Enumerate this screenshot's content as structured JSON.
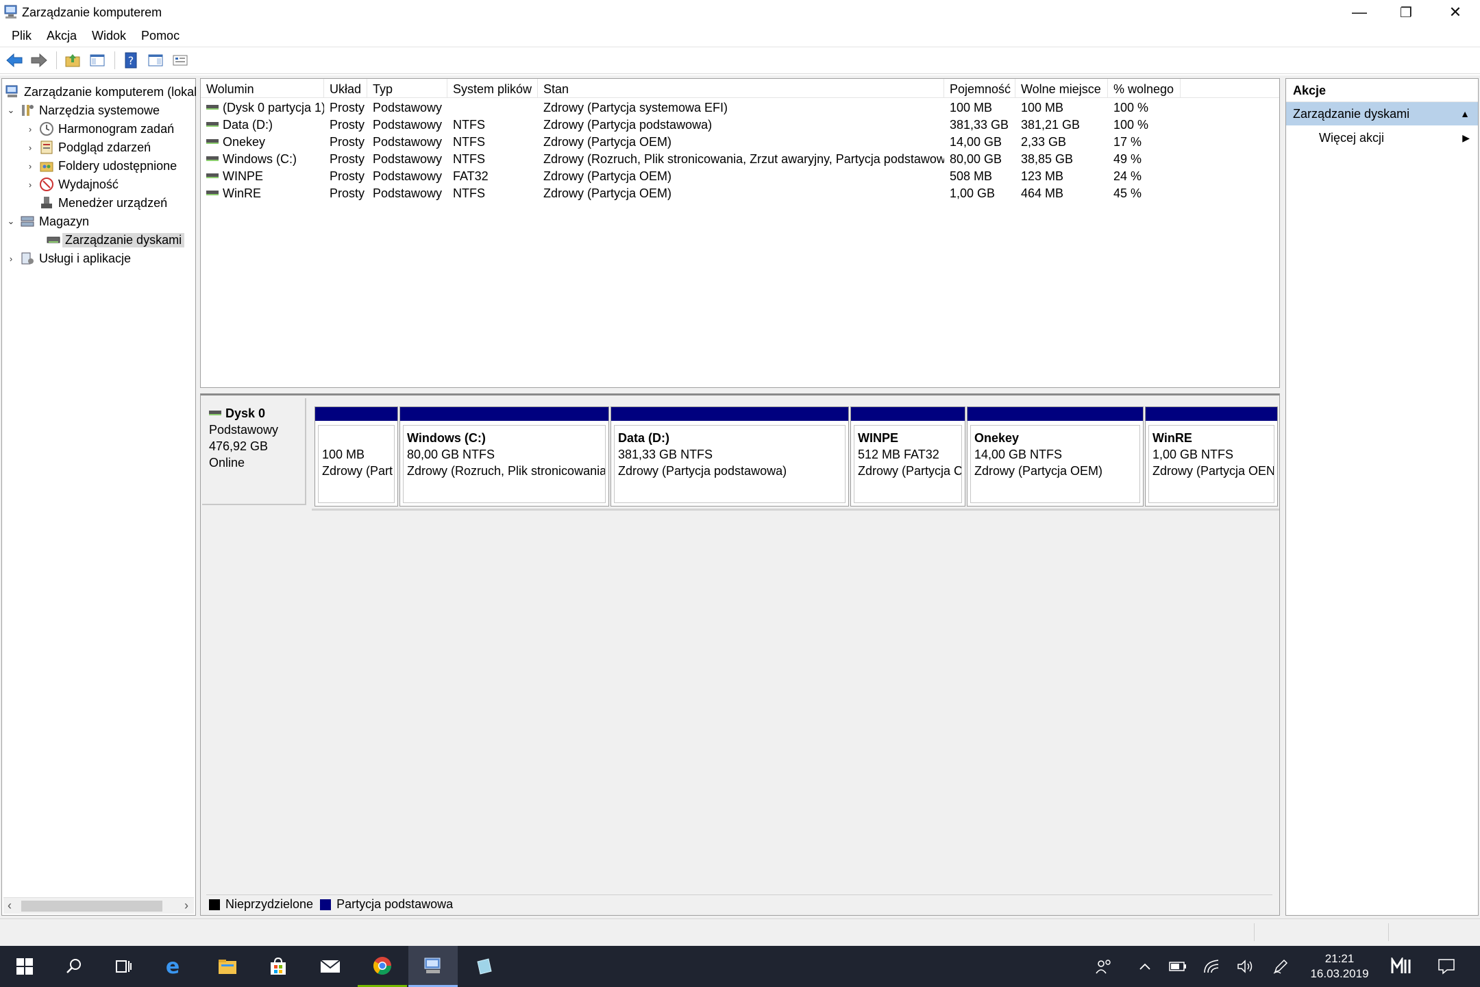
{
  "window": {
    "title": "Zarządzanie komputerem",
    "minimize": "—",
    "restore": "❐",
    "close": "✕"
  },
  "menu": [
    "Plik",
    "Akcja",
    "Widok",
    "Pomoc"
  ],
  "tree": {
    "root": "Zarządzanie komputerem (lokal",
    "items": [
      {
        "label": "Narzędzia systemowe"
      },
      {
        "label": "Harmonogram zadań"
      },
      {
        "label": "Podgląd zdarzeń"
      },
      {
        "label": "Foldery udostępnione"
      },
      {
        "label": "Wydajność"
      },
      {
        "label": "Menedżer urządzeń"
      },
      {
        "label": "Magazyn"
      },
      {
        "label": "Zarządzanie dyskami"
      },
      {
        "label": "Usługi i aplikacje"
      }
    ]
  },
  "volumes": {
    "columns": [
      "Wolumin",
      "Układ",
      "Typ",
      "System plików",
      "Stan",
      "Pojemność",
      "Wolne miejsce",
      "% wolnego"
    ],
    "rows": [
      [
        "(Dysk 0 partycja 1)",
        "Prosty",
        "Podstawowy",
        "",
        "Zdrowy (Partycja systemowa EFI)",
        "100 MB",
        "100 MB",
        "100 %"
      ],
      [
        "Data (D:)",
        "Prosty",
        "Podstawowy",
        "NTFS",
        "Zdrowy (Partycja podstawowa)",
        "381,33 GB",
        "381,21 GB",
        "100 %"
      ],
      [
        "Onekey",
        "Prosty",
        "Podstawowy",
        "NTFS",
        "Zdrowy (Partycja OEM)",
        "14,00 GB",
        "2,33 GB",
        "17 %"
      ],
      [
        "Windows (C:)",
        "Prosty",
        "Podstawowy",
        "NTFS",
        "Zdrowy (Rozruch, Plik stronicowania, Zrzut awaryjny, Partycja podstawowa)",
        "80,00 GB",
        "38,85 GB",
        "49 %"
      ],
      [
        "WINPE",
        "Prosty",
        "Podstawowy",
        "FAT32",
        "Zdrowy (Partycja OEM)",
        "508 MB",
        "123 MB",
        "24 %"
      ],
      [
        "WinRE",
        "Prosty",
        "Podstawowy",
        "NTFS",
        "Zdrowy (Partycja OEM)",
        "1,00 GB",
        "464 MB",
        "45 %"
      ]
    ]
  },
  "disk": {
    "name": "Dysk 0",
    "type": "Podstawowy",
    "size": "476,92 GB",
    "status": "Online",
    "partitions": [
      {
        "name": "",
        "size": "100 MB",
        "status": "Zdrowy (Part"
      },
      {
        "name": "Windows  (C:)",
        "size": "80,00 GB NTFS",
        "status": "Zdrowy (Rozruch, Plik stronicowania"
      },
      {
        "name": "Data  (D:)",
        "size": "381,33 GB NTFS",
        "status": "Zdrowy (Partycja podstawowa)"
      },
      {
        "name": "WINPE",
        "size": "512 MB FAT32",
        "status": "Zdrowy (Partycja C"
      },
      {
        "name": "Onekey",
        "size": "14,00 GB NTFS",
        "status": "Zdrowy (Partycja OEM)"
      },
      {
        "name": "WinRE",
        "size": "1,00 GB NTFS",
        "status": "Zdrowy (Partycja OEN"
      }
    ]
  },
  "legend": [
    {
      "label": "Nieprzydzielone",
      "color": "#000000"
    },
    {
      "label": "Partycja podstawowa",
      "color": "#00007f"
    }
  ],
  "actions": {
    "title": "Akcje",
    "section": "Zarządzanie dyskami",
    "more": "Więcej akcji"
  },
  "taskbar": {
    "time": "21:21",
    "date": "16.03.2019"
  },
  "icons": {
    "accent": "#00007f",
    "selection": "#b8d1ea"
  }
}
